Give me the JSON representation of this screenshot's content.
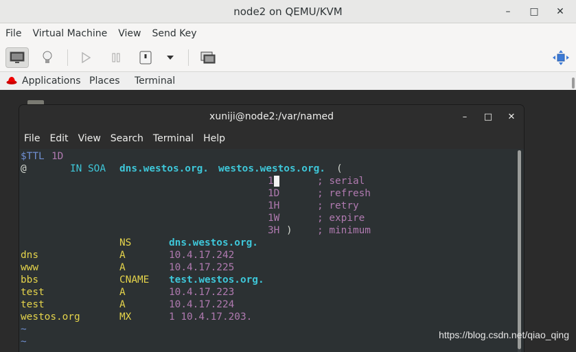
{
  "vm_window": {
    "title": "node2 on QEMU/KVM",
    "minimize": "–",
    "maximize": "□",
    "close": "✕",
    "menu": [
      "File",
      "Virtual Machine",
      "View",
      "Send Key"
    ]
  },
  "guest_topbar": {
    "applications": "Applications",
    "places": "Places",
    "terminal": "Terminal"
  },
  "terminal": {
    "title": "xuniji@node2:/var/named",
    "menu": [
      "File",
      "Edit",
      "View",
      "Search",
      "Terminal",
      "Help"
    ],
    "soa": {
      "ttl_kw": "$TTL",
      "ttl_val": "1D",
      "at": "@",
      "in_soa": "IN SOA",
      "primary": "dns.westos.org.",
      "contact": "westos.westos.org.",
      "paren_open": "(",
      "serial_val": "1",
      "serial_comment": "; serial",
      "refresh_val": "1D",
      "refresh_comment": "; refresh",
      "retry_val": "1H",
      "retry_comment": "; retry",
      "expire_val": "1W",
      "expire_comment": "; expire",
      "minimum_val": "3H",
      "paren_close": ")",
      "minimum_comment": "; minimum"
    },
    "records": [
      {
        "name": "",
        "type": "NS",
        "value": "dns.westos.org."
      },
      {
        "name": "dns",
        "type": "A",
        "value": "10.4.17.242"
      },
      {
        "name": "www",
        "type": "A",
        "value": "10.4.17.225"
      },
      {
        "name": "bbs",
        "type": "CNAME",
        "value": "test.westos.org."
      },
      {
        "name": "test",
        "type": "A",
        "value": "10.4.17.223"
      },
      {
        "name": "test",
        "type": "A",
        "value": "10.4.17.224"
      },
      {
        "name": "westos.org",
        "type": "MX",
        "value": "1 10.4.17.203."
      }
    ],
    "tilde": "~"
  },
  "watermark": "https://blog.csdn.net/qiao_qing"
}
